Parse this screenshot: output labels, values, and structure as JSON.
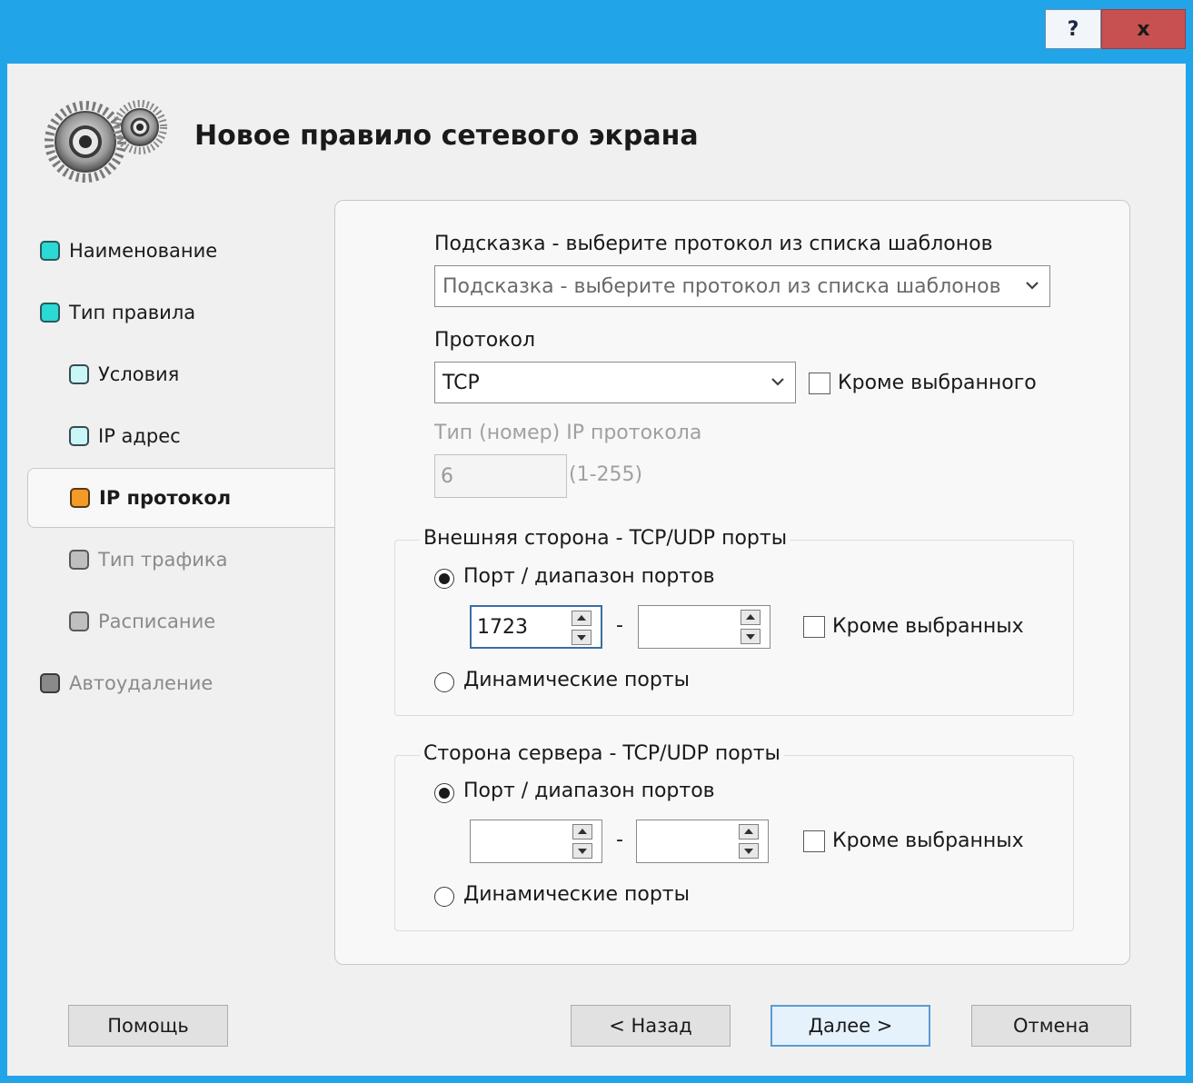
{
  "titlebar": {
    "help_label": "?",
    "close_label": "x"
  },
  "header": {
    "title": "Новое правило сетевого экрана",
    "icon": "gears-icon"
  },
  "nav": {
    "items": [
      {
        "label": "Наименование",
        "state": "done"
      },
      {
        "label": "Тип правила",
        "state": "done"
      },
      {
        "label": "Условия",
        "state": "done-sub"
      },
      {
        "label": "IP адрес",
        "state": "done-sub"
      },
      {
        "label": "IP протокол",
        "state": "active"
      },
      {
        "label": "Тип трафика",
        "state": "pending"
      },
      {
        "label": "Расписание",
        "state": "pending"
      },
      {
        "label": "Автоудаление",
        "state": "pending"
      }
    ]
  },
  "form": {
    "template_label": "Подсказка - выберите протокол из списка шаблонов",
    "template_value": "Подсказка - выберите протокол из списка шаблонов",
    "protocol_label": "Протокол",
    "protocol_value": "TCP",
    "protocol_except_label": "Кроме выбранного",
    "ip_type_label": "Тип (номер) IP протокола",
    "ip_type_value": "6",
    "ip_type_range": "(1-255)"
  },
  "external": {
    "title": "Внешняя сторона - TCP/UDP порты",
    "port_range_label": "Порт / диапазон портов",
    "port_from": "1723",
    "port_to": "",
    "dash": "-",
    "except_label": "Кроме выбранных",
    "dynamic_label": "Динамические порты"
  },
  "server": {
    "title": "Сторона сервера - TCP/UDP порты",
    "port_range_label": "Порт / диапазон портов",
    "port_from": "",
    "port_to": "",
    "dash": "-",
    "except_label": "Кроме выбранных",
    "dynamic_label": "Динамические порты"
  },
  "buttons": {
    "help": "Помощь",
    "back": "< Назад",
    "next": "Далее >",
    "cancel": "Отмена"
  },
  "colors": {
    "titlebar": "#21a4e8",
    "close": "#c75050",
    "done": "#2bd9d5",
    "active": "#f49a2a"
  }
}
